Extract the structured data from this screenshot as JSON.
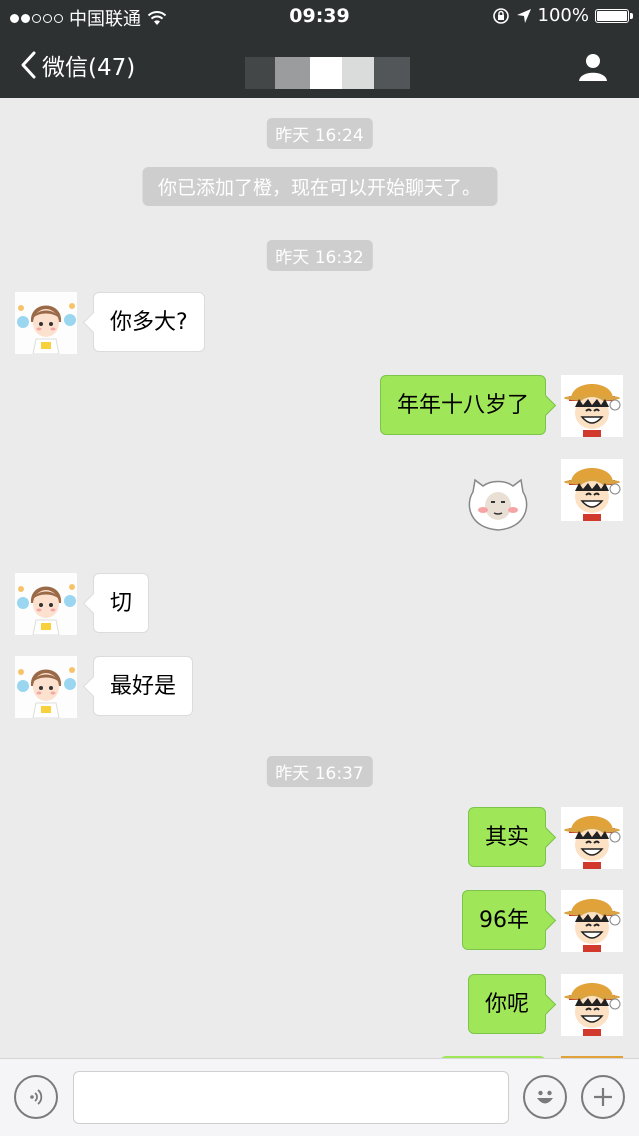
{
  "status_bar": {
    "carrier": "中国联通",
    "time": "09:39",
    "battery": "100%"
  },
  "nav": {
    "back_label": "微信(47)"
  },
  "chat": {
    "timestamps": [
      "昨天 16:24",
      "昨天 16:32",
      "昨天 16:37"
    ],
    "system_message": "你已添加了橙，现在可以开始聊天了。",
    "messages": [
      {
        "side": "in",
        "text": "你多大?"
      },
      {
        "side": "out",
        "text": "年年十八岁了"
      },
      {
        "side": "out",
        "type": "sticker",
        "text": ""
      },
      {
        "side": "in",
        "text": "切"
      },
      {
        "side": "in",
        "text": "最好是"
      },
      {
        "side": "out",
        "text": "其实"
      },
      {
        "side": "out",
        "text": "96年"
      },
      {
        "side": "out",
        "text": "你呢"
      }
    ]
  },
  "input": {
    "value": "",
    "placeholder": ""
  },
  "icons": {
    "back": "chevron-left-icon",
    "contact": "person-icon",
    "voice": "voice-icon",
    "emoji": "emoji-icon",
    "more": "plus-icon",
    "wifi": "wifi-icon",
    "location": "location-arrow-icon",
    "lock": "orientation-lock-icon"
  },
  "colors": {
    "nav_bg": "#2e3132",
    "chat_bg": "#ebebeb",
    "outgoing_bubble": "#9fe659",
    "incoming_bubble": "#ffffff",
    "timestamp_bg": "#cecece"
  }
}
